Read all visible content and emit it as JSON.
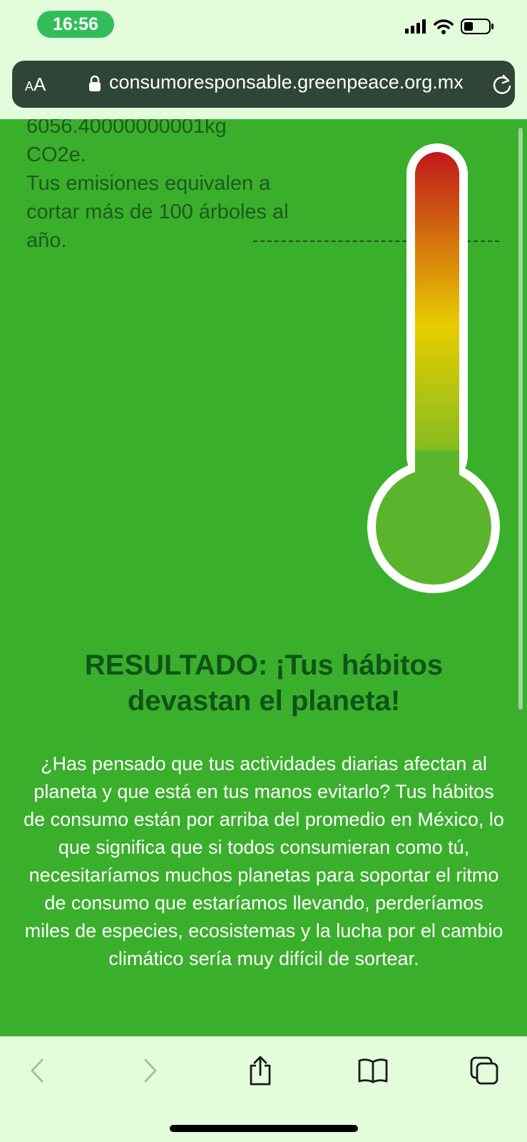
{
  "status_bar": {
    "time": "16:56"
  },
  "browser": {
    "text_size_label_small": "A",
    "text_size_label_large": "A",
    "url": "consumoresponsable.greenpeace.org.mx"
  },
  "result": {
    "emissions_lines": [
      "6056.40000000001kg",
      "CO2e.",
      "Tus emisiones equivalen a",
      "cortar más de 100 árboles al",
      "año."
    ],
    "heading": "RESULTADO: ¡Tus hábitos devastan el planeta!",
    "body": "¿Has pensado que tus actividades diarias afectan al planeta y que está en tus manos evitarlo? Tus hábitos de consumo están por arriba del promedio en México, lo que significa que si todos consumieran como tú, necesitaríamos muchos planetas para soportar el ritmo de consumo que estaríamos llevando, perderíamos miles de especies, ecosistemas y la lucha por el cambio climático sería muy difícil de sortear."
  },
  "thermometer": {
    "level_fraction": 0.85,
    "colors": [
      "#c0171c",
      "#e8cd00",
      "#5bb52c"
    ]
  },
  "colors": {
    "page_background": "#3aaf2c",
    "heading": "#0f5418",
    "emissions_text": "#1e5a1e",
    "chrome_background": "#e3fcdc",
    "address_bar": "#2f4537"
  },
  "toolbar": {
    "icons": [
      "back-icon",
      "forward-icon",
      "share-icon",
      "bookmarks-icon",
      "tabs-icon"
    ]
  }
}
